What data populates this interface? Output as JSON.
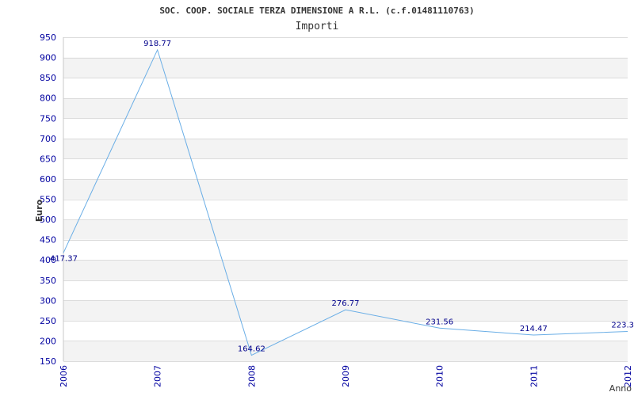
{
  "chart_data": {
    "type": "line",
    "title": "SOC. COOP. SOCIALE TERZA DIMENSIONE A R.L. (c.f.01481110763)",
    "subtitle": "Importi",
    "xlabel": "Anno",
    "ylabel": "Euro",
    "x": [
      "2006",
      "2007",
      "2008",
      "2009",
      "2010",
      "2011",
      "2012"
    ],
    "values": [
      417.37,
      918.77,
      164.62,
      276.77,
      231.56,
      214.47,
      223.3
    ],
    "value_labels": [
      "417.37",
      "918.77",
      "164.62",
      "276.77",
      "231.56",
      "214.47",
      "223.3"
    ],
    "ylim": [
      150,
      950
    ],
    "yticks": [
      "150",
      "200",
      "250",
      "300",
      "350",
      "400",
      "450",
      "500",
      "550",
      "600",
      "650",
      "700",
      "750",
      "800",
      "850",
      "900",
      "950"
    ],
    "grid": true,
    "line_color": "#6aaee6",
    "label_color": "#00008b",
    "tick_color": "#0000a0"
  }
}
